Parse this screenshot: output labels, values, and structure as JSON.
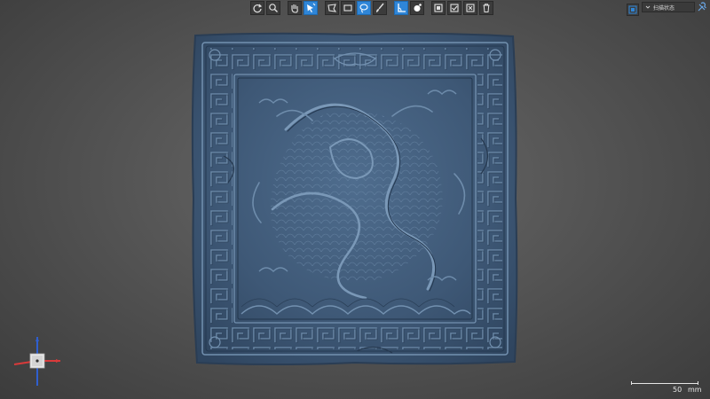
{
  "toolbar": {
    "buttons": [
      {
        "icon": "rotate-reset-icon",
        "active": false
      },
      {
        "icon": "zoom-icon",
        "active": false
      },
      {
        "icon": "hand-select-icon",
        "active": false
      },
      {
        "icon": "cursor-select-icon",
        "active": true
      },
      {
        "icon": "polygon-select-icon",
        "active": false
      },
      {
        "icon": "rectangle-select-icon",
        "active": false
      },
      {
        "icon": "lasso-select-icon",
        "active": true
      },
      {
        "icon": "brush-icon",
        "active": false
      },
      {
        "icon": "angle-select-icon",
        "active": true
      },
      {
        "icon": "visibility-toggle-icon",
        "active": false
      },
      {
        "icon": "invert-selection-icon",
        "active": false
      },
      {
        "icon": "select-all-icon",
        "active": false
      },
      {
        "icon": "deselect-icon",
        "active": false
      },
      {
        "icon": "trash-icon",
        "active": false
      }
    ]
  },
  "status_panel": {
    "dropdown_label": "扫描状态"
  },
  "scale_bar": {
    "value": "50",
    "unit": "mm"
  },
  "colors": {
    "selected_tool": "#2f86d8",
    "model_surface": "#3f5a78",
    "axis_x": "#d93a3a",
    "axis_y": "#2f5fd0"
  }
}
